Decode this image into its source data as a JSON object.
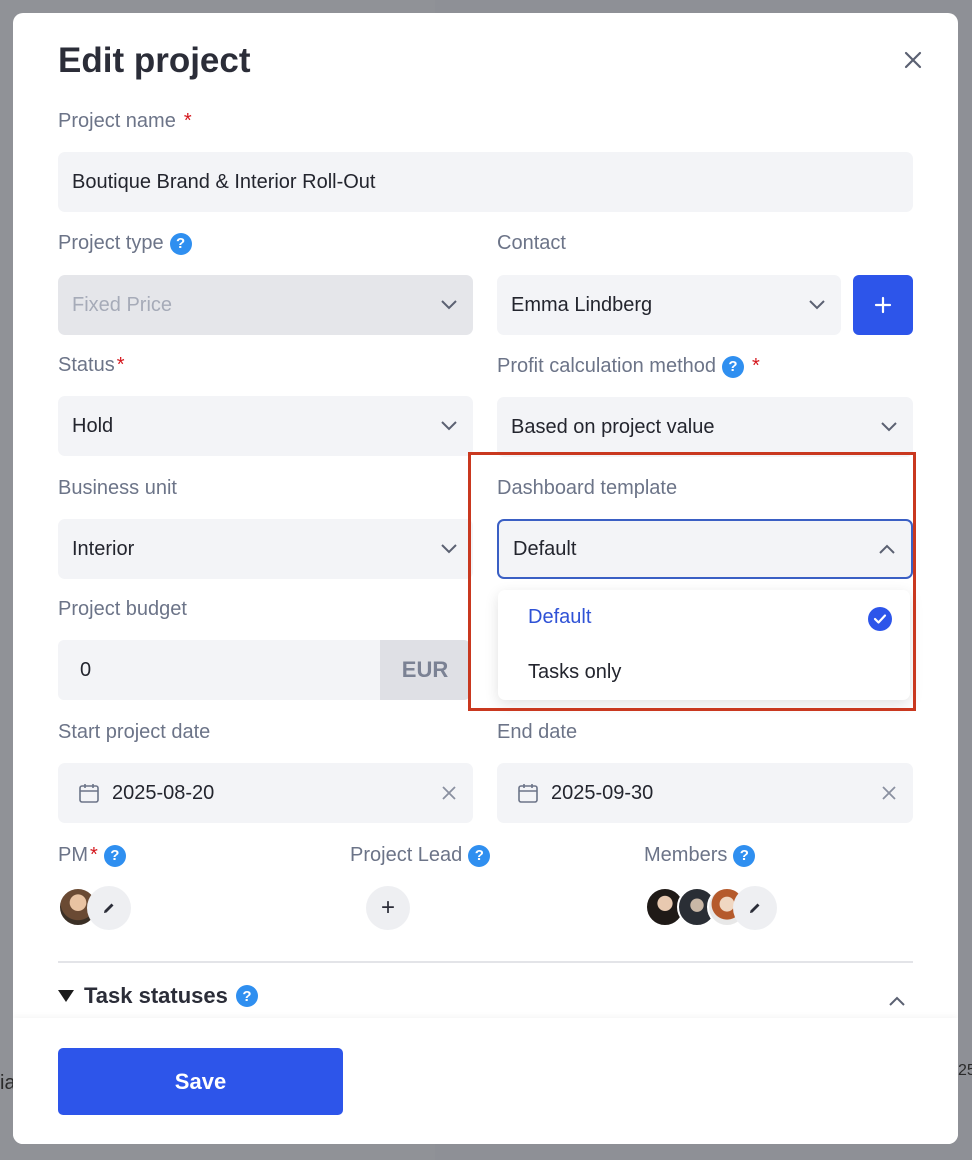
{
  "background": {
    "left_text": "ia",
    "right_text": "25"
  },
  "modal": {
    "title": "Edit project",
    "close_label": "×"
  },
  "fields": {
    "project_name": {
      "label": "Project name",
      "required": "*",
      "value": "Boutique Brand & Interior Roll-Out"
    },
    "project_type": {
      "label": "Project type",
      "help": "?",
      "value": "Fixed Price",
      "disabled": true
    },
    "contact": {
      "label": "Contact",
      "value": "Emma Lindberg",
      "add_label": "+"
    },
    "status": {
      "label": "Status",
      "required": "*",
      "value": "Hold"
    },
    "profit_method": {
      "label": "Profit calculation method",
      "help": "?",
      "required": "*",
      "value": "Based on project value"
    },
    "business_unit": {
      "label": "Business unit",
      "value": "Interior"
    },
    "dashboard_template": {
      "label": "Dashboard template",
      "value": "Default",
      "open": true,
      "options": [
        {
          "label": "Default",
          "selected": true
        },
        {
          "label": "Tasks only",
          "selected": false
        }
      ]
    },
    "project_budget": {
      "label": "Project budget",
      "value": "0",
      "currency": "EUR"
    },
    "start_date": {
      "label": "Start project date",
      "value": "2025-08-20"
    },
    "end_date": {
      "label": "End date",
      "value": "2025-09-30"
    }
  },
  "people": {
    "pm": {
      "label": "PM",
      "required": "*",
      "help": "?"
    },
    "project_lead": {
      "label": "Project Lead",
      "help": "?",
      "add_label": "+"
    },
    "members": {
      "label": "Members",
      "help": "?"
    }
  },
  "task_statuses": {
    "label": "Task statuses",
    "help": "?"
  },
  "footer": {
    "save_label": "Save"
  },
  "colors": {
    "primary": "#2d55ea",
    "help": "#2f8ff0",
    "required": "#d4161c",
    "highlight": "#c9381f",
    "selected_option": "#2f52d6"
  }
}
